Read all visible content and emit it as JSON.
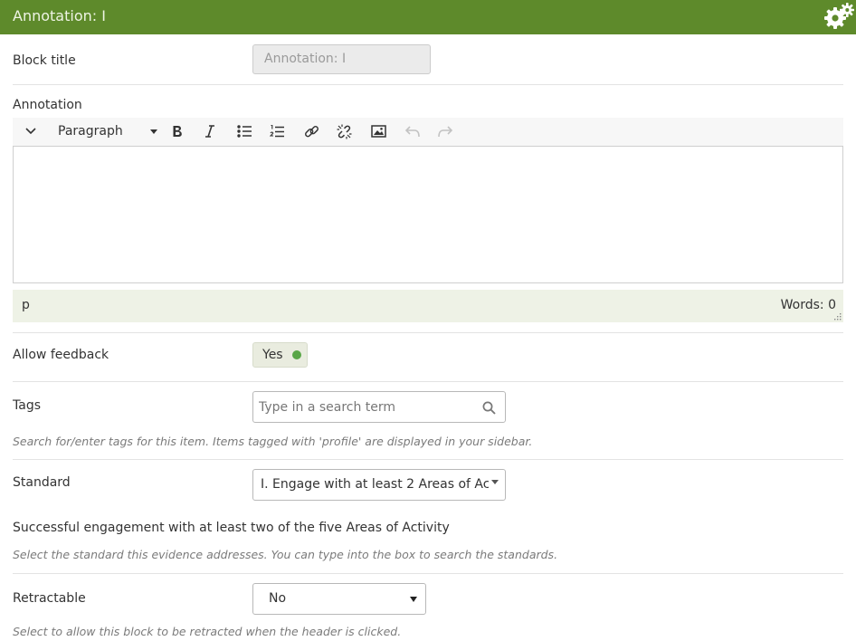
{
  "header": {
    "title": "Annotation: I",
    "icon": "gears-icon",
    "bg_color": "#5e8a2b"
  },
  "block_title": {
    "label": "Block title",
    "value": "Annotation: I"
  },
  "annotation": {
    "label": "Annotation",
    "toolbar": {
      "format_select": "Paragraph",
      "buttons": [
        "toggle-toolbar-icon",
        "bold-icon",
        "italic-icon",
        "bullet-list-icon",
        "numbered-list-icon",
        "link-icon",
        "unlink-icon",
        "image-icon",
        "undo-icon",
        "redo-icon"
      ]
    },
    "content": "",
    "path": "p",
    "word_count": "Words: 0"
  },
  "allow_feedback": {
    "label": "Allow feedback",
    "value": "Yes",
    "on_color": "#58a646"
  },
  "tags": {
    "label": "Tags",
    "placeholder": "Type in a search term",
    "help": "Search for/enter tags for this item. Items tagged with 'profile' are displayed in your sidebar."
  },
  "standard": {
    "label": "Standard",
    "selected": "I. Engage with at least 2 Areas of Ac...",
    "description": "Successful engagement with at least two of the five Areas of Activity",
    "help": "Select the standard this evidence addresses. You can type into the box to search the standards."
  },
  "retractable": {
    "label": "Retractable",
    "selected": "No",
    "help": "Select to allow this block to be retracted when the header is clicked."
  }
}
